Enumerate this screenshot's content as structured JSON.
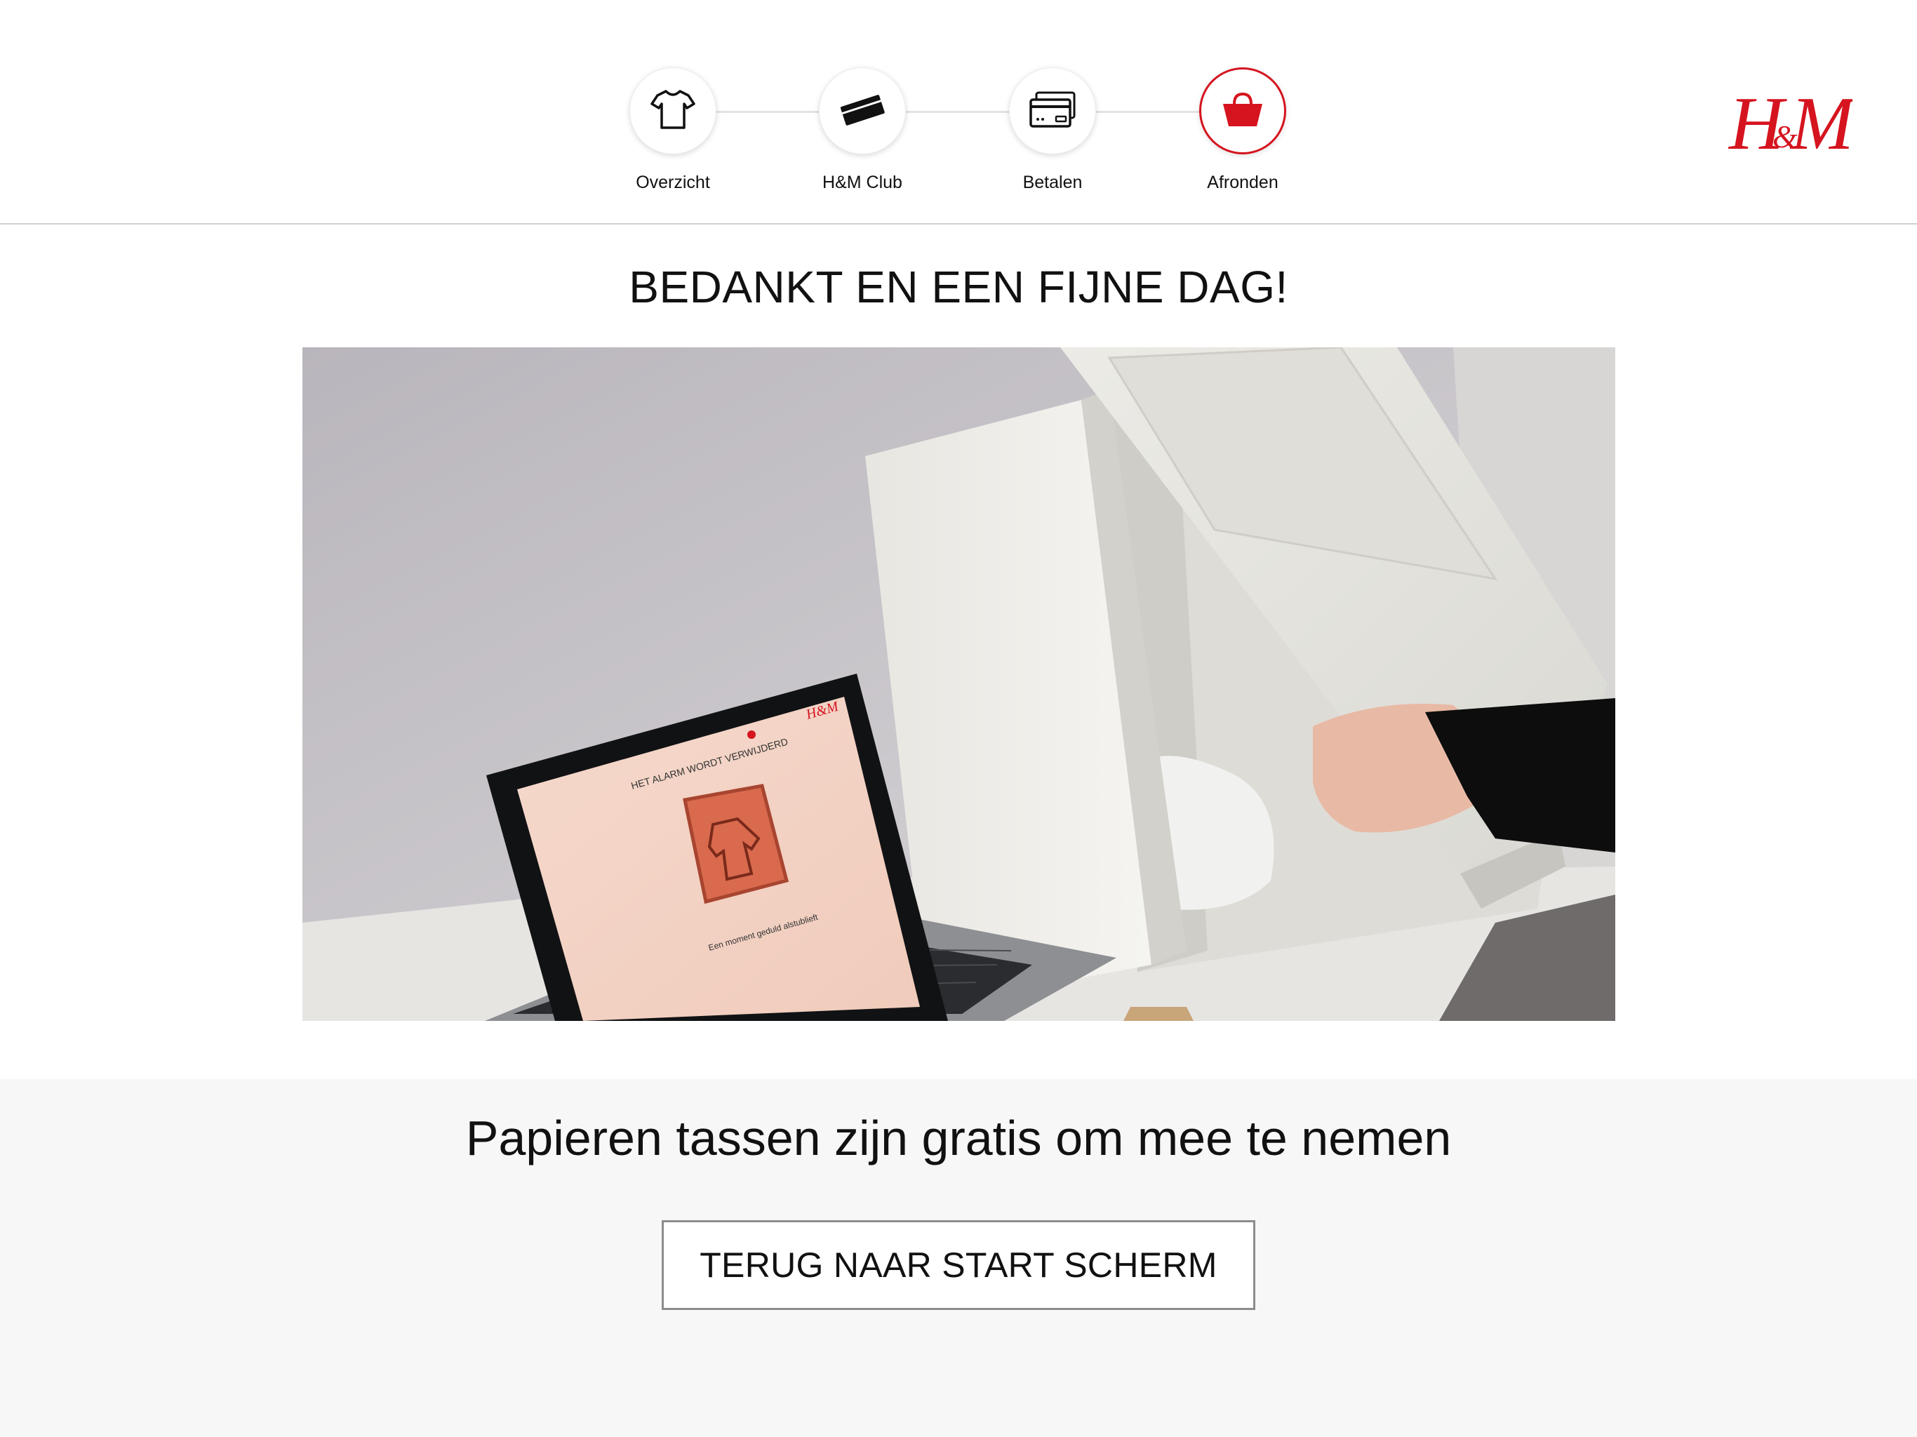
{
  "stepper": {
    "steps": [
      {
        "label": "Overzicht",
        "icon": "tshirt-icon",
        "active": false
      },
      {
        "label": "H&M Club",
        "icon": "card-icon",
        "active": false
      },
      {
        "label": "Betalen",
        "icon": "credit-cards-icon",
        "active": false
      },
      {
        "label": "Afronden",
        "icon": "shopping-bag-icon",
        "active": true
      }
    ]
  },
  "brand": {
    "logo_text": "H&M",
    "accent_color": "#d5141f"
  },
  "main": {
    "title": "BEDANKT EN EEN FIJNE DAG!",
    "image_description_icon": "alarm-removal-video"
  },
  "laptop_screen": {
    "heading": "HET ALARM WORDT VERWIJDERD",
    "status": "Een moment geduld alstublieft"
  },
  "footer": {
    "message": "Papieren tassen zijn gratis om mee te nemen",
    "back_button": "TERUG NAAR START SCHERM"
  }
}
